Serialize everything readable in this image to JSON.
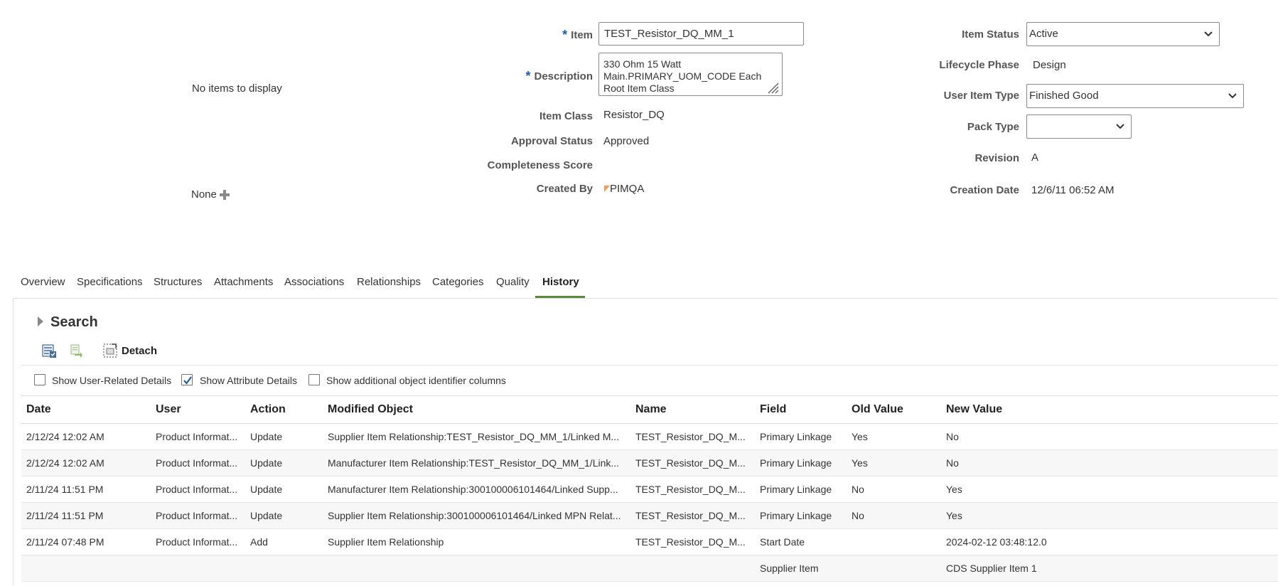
{
  "left": {
    "no_items": "No items to display",
    "none_label": "None"
  },
  "form": {
    "item_label": "Item",
    "item_value": "TEST_Resistor_DQ_MM_1",
    "description_label": "Description",
    "description_value": "330 Ohm 15 Watt\nMain.PRIMARY_UOM_CODE Each\nRoot Item Class",
    "item_class_label": "Item Class",
    "item_class_value": "Resistor_DQ",
    "approval_status_label": "Approval Status",
    "approval_status_value": "Approved",
    "completeness_label": "Completeness Score",
    "created_by_label": "Created By",
    "created_by_value": "PIMQA",
    "item_status_label": "Item Status",
    "item_status_value": "Active",
    "lifecycle_label": "Lifecycle Phase",
    "lifecycle_value": "Design",
    "user_item_type_label": "User Item Type",
    "user_item_type_value": "Finished Good",
    "pack_type_label": "Pack Type",
    "pack_type_value": "",
    "revision_label": "Revision",
    "revision_value": "A",
    "creation_date_label": "Creation Date",
    "creation_date_value": "12/6/11 06:52 AM"
  },
  "tabs": [
    {
      "label": "Overview"
    },
    {
      "label": "Specifications"
    },
    {
      "label": "Structures"
    },
    {
      "label": "Attachments"
    },
    {
      "label": "Associations"
    },
    {
      "label": "Relationships"
    },
    {
      "label": "Categories"
    },
    {
      "label": "Quality"
    },
    {
      "label": "History"
    }
  ],
  "active_tab": "History",
  "history": {
    "search_label": "Search",
    "detach_label": "Detach",
    "checkboxes": [
      {
        "label": "Show User-Related Details",
        "checked": false
      },
      {
        "label": "Show Attribute Details",
        "checked": true
      },
      {
        "label": "Show additional object identifier columns",
        "checked": false
      }
    ],
    "columns": [
      "Date",
      "User",
      "Action",
      "Modified Object",
      "Name",
      "Field",
      "Old Value",
      "New Value"
    ],
    "rows": [
      [
        "2/12/24 12:02 AM",
        "Product Informat...",
        "Update",
        "Supplier Item Relationship:TEST_Resistor_DQ_MM_1/Linked M...",
        "TEST_Resistor_DQ_M...",
        "Primary Linkage",
        "Yes",
        "No"
      ],
      [
        "2/12/24 12:02 AM",
        "Product Informat...",
        "Update",
        "Manufacturer Item Relationship:TEST_Resistor_DQ_MM_1/Link...",
        "TEST_Resistor_DQ_M...",
        "Primary Linkage",
        "Yes",
        "No"
      ],
      [
        "2/11/24 11:51 PM",
        "Product Informat...",
        "Update",
        "Manufacturer Item Relationship:300100006101464/Linked Supp...",
        "TEST_Resistor_DQ_M...",
        "Primary Linkage",
        "No",
        "Yes"
      ],
      [
        "2/11/24 11:51 PM",
        "Product Informat...",
        "Update",
        "Supplier Item Relationship:300100006101464/Linked MPN Relat...",
        "TEST_Resistor_DQ_M...",
        "Primary Linkage",
        "No",
        "Yes"
      ],
      [
        "2/11/24 07:48 PM",
        "Product Informat...",
        "Add",
        "Supplier Item Relationship",
        "TEST_Resistor_DQ_M...",
        "Start Date",
        "",
        "2024-02-12 03:48:12.0"
      ],
      [
        "",
        "",
        "",
        "",
        "",
        "Supplier Item",
        "",
        "CDS Supplier Item 1"
      ]
    ]
  },
  "colors": {
    "accent_blue": "#1c5fa8",
    "tab_underline": "#5a8a3c",
    "created_by_flag": "#f29b5b"
  }
}
